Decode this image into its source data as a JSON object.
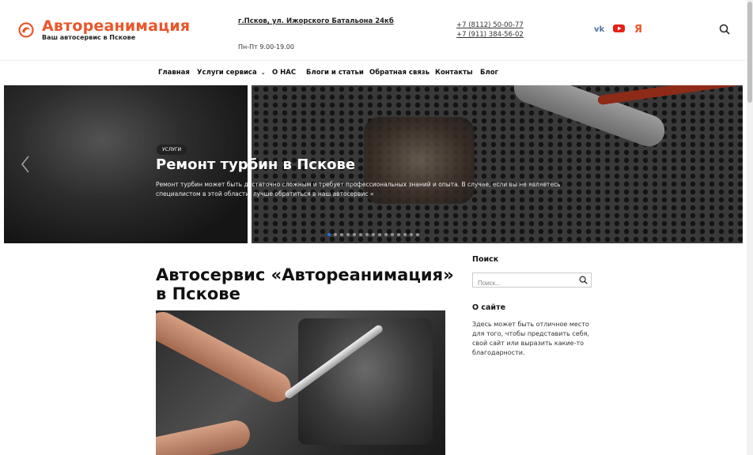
{
  "header": {
    "logo_title": "Автореанимация",
    "logo_subtitle": "Ваш автосервис в Пскове",
    "address": "г.Псков, ул. Ижорского Батальона 24кб",
    "hours": "Пн-Пт 9.00-19.00",
    "phones": [
      "+7 (8112) 50-00-77",
      "+7 (911) 384-56-02"
    ],
    "social_icons": [
      "vk-icon",
      "youtube-icon",
      "yandex-icon"
    ],
    "colors": {
      "brand": "#e8572a",
      "vk": "#4c75a3",
      "youtube": "#e62117",
      "yandex": "#e8572a"
    }
  },
  "nav": {
    "items": [
      {
        "label": "Главная"
      },
      {
        "label": "Услуги сервиса"
      },
      {
        "label": "О НАС"
      },
      {
        "label": "Блоги и статьи"
      },
      {
        "label": "Обратная связь"
      },
      {
        "label": "Контакты"
      },
      {
        "label": "Блог"
      }
    ]
  },
  "slider": {
    "badge": "УСЛУГИ",
    "title": "Ремонт турбин в Пскове",
    "excerpt": "Ремонт турбин может быть достаточно сложным и требует профессиональных знаний и опыта. В случае, если вы не являетесь специалистом в этой области, лучше обратиться в наш автосервис «",
    "total_slides": 15,
    "active_slide": 1
  },
  "main": {
    "title": "Автосервис «Автореанимация» в Пскове"
  },
  "sidebar": {
    "search_heading": "Поиск",
    "search_placeholder": "Поиск...",
    "about_heading": "О сайте",
    "about_text": "Здесь может быть отличное место для того, чтобы представить себя, свой сайт или выразить какие-то благодарности."
  }
}
